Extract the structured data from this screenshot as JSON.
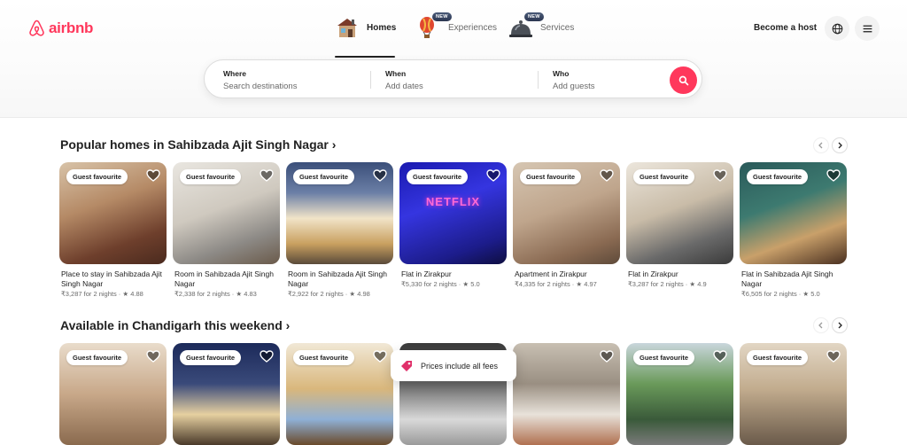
{
  "brand": {
    "name": "airbnb",
    "color": "#ff385c"
  },
  "nav": [
    {
      "label": "Homes",
      "icon": "house-icon",
      "active": true
    },
    {
      "label": "Experiences",
      "icon": "hot-air-balloon-icon",
      "badge": "NEW"
    },
    {
      "label": "Services",
      "icon": "service-bell-icon",
      "badge": "NEW"
    }
  ],
  "header": {
    "become_host": "Become a host",
    "globe_icon": "globe-icon",
    "menu_icon": "menu-icon"
  },
  "search": {
    "where": {
      "label": "Where",
      "placeholder": "Search destinations"
    },
    "when": {
      "label": "When",
      "placeholder": "Add dates"
    },
    "who": {
      "label": "Who",
      "placeholder": "Add guests"
    }
  },
  "sections": [
    {
      "title": "Popular homes in Sahibzada Ajit Singh Nagar ›",
      "cards": [
        {
          "badge": "Guest favourite",
          "title": "Place to stay in Sahibzada Ajit Singh Nagar",
          "meta": "₹3,287 for 2 nights · ★ 4.88"
        },
        {
          "badge": "Guest favourite",
          "title": "Room in Sahibzada Ajit Singh Nagar",
          "meta": "₹2,338 for 2 nights · ★ 4.83"
        },
        {
          "badge": "Guest favourite",
          "title": "Room in Sahibzada Ajit Singh Nagar",
          "meta": "₹2,922 for 2 nights · ★ 4.98"
        },
        {
          "badge": "Guest favourite",
          "title": "Flat in Zirakpur",
          "meta": "₹5,330 for 2 nights · ★ 5.0",
          "photo_text": "NETFLIX"
        },
        {
          "badge": "Guest favourite",
          "title": "Apartment in Zirakpur",
          "meta": "₹4,335 for 2 nights · ★ 4.97"
        },
        {
          "badge": "Guest favourite",
          "title": "Flat in Zirakpur",
          "meta": "₹3,287 for 2 nights · ★ 4.9"
        },
        {
          "badge": "Guest favourite",
          "title": "Flat in Sahibzada Ajit Singh Nagar",
          "meta": "₹6,505 for 2 nights · ★ 5.0"
        }
      ]
    },
    {
      "title": "Available in Chandigarh this weekend ›",
      "cards": [
        {
          "badge": "Guest favourite"
        },
        {
          "badge": "Guest favourite"
        },
        {
          "badge": "Guest favourite"
        },
        {
          "badge": ""
        },
        {
          "badge": ""
        },
        {
          "badge": "Guest favourite"
        },
        {
          "badge": "Guest favourite"
        }
      ]
    }
  ],
  "tooltip": {
    "text": "Prices include all fees",
    "icon": "price-tag-icon"
  }
}
